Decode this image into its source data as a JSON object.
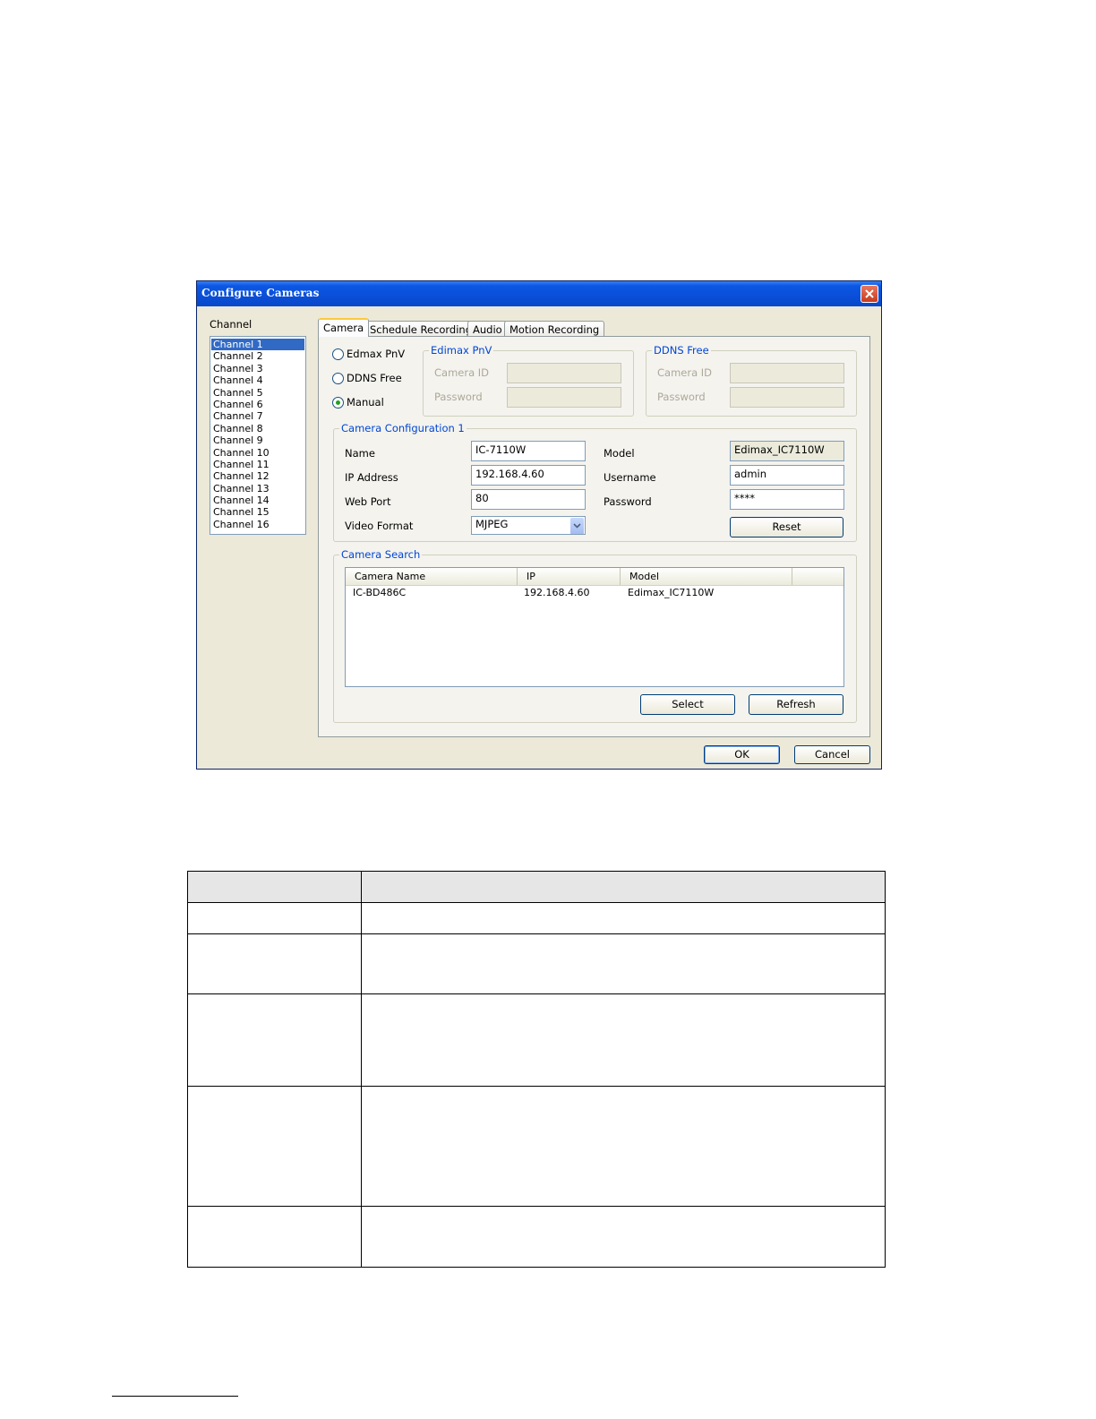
{
  "dialog": {
    "title": "Configure Cameras",
    "channel_label": "Channel",
    "channels": [
      "Channel 1",
      "Channel 2",
      "Channel 3",
      "Channel 4",
      "Channel 5",
      "Channel 6",
      "Channel 7",
      "Channel 8",
      "Channel 9",
      "Channel 10",
      "Channel 11",
      "Channel 12",
      "Channel 13",
      "Channel 14",
      "Channel 15",
      "Channel 16"
    ],
    "selected_channel": "Channel 1",
    "tabs": [
      "Camera",
      "Schedule Recording",
      "Audio",
      "Motion Recording"
    ],
    "active_tab": "Camera",
    "mode_options": [
      "Edmax PnV",
      "DDNS Free",
      "Manual"
    ],
    "selected_mode": "Manual",
    "edimax_group": {
      "title": "Edimax PnV",
      "camera_id_label": "Camera ID",
      "password_label": "Password"
    },
    "ddns_group": {
      "title": "DDNS Free",
      "camera_id_label": "Camera ID",
      "password_label": "Password"
    },
    "config": {
      "title": "Camera Configuration 1",
      "name_label": "Name",
      "name_value": "IC-7110W",
      "ip_label": "IP Address",
      "ip_value": "192.168.4.60",
      "port_label": "Web Port",
      "port_value": "80",
      "format_label": "Video Format",
      "format_value": "MJPEG",
      "model_label": "Model",
      "model_value": "Edimax_IC7110W",
      "username_label": "Username",
      "username_value": "admin",
      "password_label": "Password",
      "password_value": "****",
      "reset_label": "Reset"
    },
    "search": {
      "title": "Camera Search",
      "columns": [
        "Camera Name",
        "IP",
        "Model"
      ],
      "rows": [
        [
          "IC-BD486C",
          "192.168.4.60",
          "Edimax_IC7110W"
        ]
      ],
      "select_label": "Select",
      "refresh_label": "Refresh"
    },
    "ok_label": "OK",
    "cancel_label": "Cancel"
  },
  "colors": {
    "titlebar": "#0b57e3",
    "selection": "#316ac5",
    "group_title": "#0046d5",
    "table_header": "#e6e6e6"
  }
}
